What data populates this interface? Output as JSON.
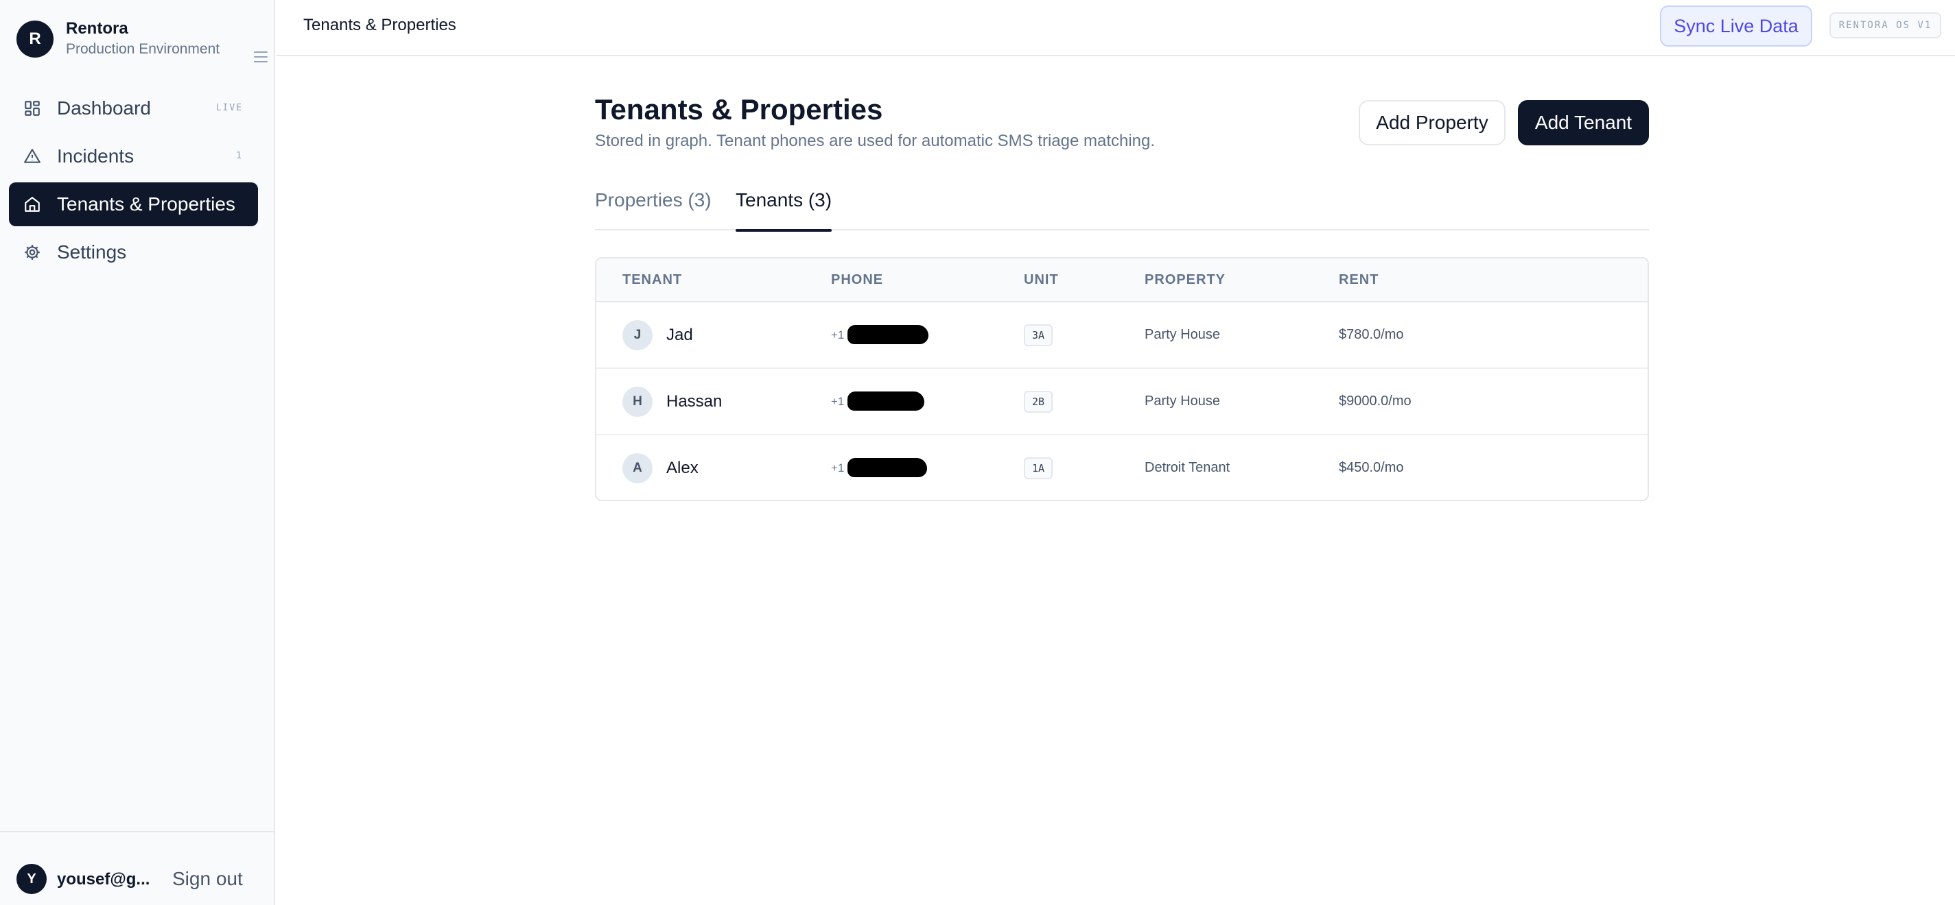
{
  "brand": {
    "initial": "R",
    "name": "Rentora",
    "environment": "Production Environment"
  },
  "sidebar": {
    "items": [
      {
        "label": "Dashboard",
        "badge": "LIVE",
        "icon": "dashboard-icon"
      },
      {
        "label": "Incidents",
        "badge": "1",
        "icon": "warning-triangle-icon"
      },
      {
        "label": "Tenants & Properties",
        "badge": "",
        "icon": "home-icon",
        "active": true
      },
      {
        "label": "Settings",
        "badge": "",
        "icon": "gear-icon"
      }
    ]
  },
  "user": {
    "initial": "Y",
    "email": "yousef@g...",
    "sign_out_label": "Sign out"
  },
  "topbar": {
    "title": "Tenants & Properties",
    "sync_label": "Sync Live Data",
    "version": "RENTORA OS V1"
  },
  "page": {
    "title": "Tenants & Properties",
    "subtitle": "Stored in graph. Tenant phones are used for automatic SMS triage matching.",
    "add_property_label": "Add Property",
    "add_tenant_label": "Add Tenant"
  },
  "tabs": [
    {
      "label": "Properties (3)",
      "active": false
    },
    {
      "label": "Tenants (3)",
      "active": true
    }
  ],
  "table": {
    "headers": [
      "TENANT",
      "PHONE",
      "UNIT",
      "PROPERTY",
      "RENT"
    ],
    "rows": [
      {
        "initial": "J",
        "name": "Jad",
        "phone_prefix": "+1",
        "unit": "3A",
        "property": "Party House",
        "rent": "$780.0/mo"
      },
      {
        "initial": "H",
        "name": "Hassan",
        "phone_prefix": "+1",
        "unit": "2B",
        "property": "Party House",
        "rent": "$9000.0/mo"
      },
      {
        "initial": "A",
        "name": "Alex",
        "phone_prefix": "+1",
        "unit": "1A",
        "property": "Detroit Tenant",
        "rent": "$450.0/mo"
      }
    ]
  },
  "colors": {
    "primary": "#0f172a",
    "accent": "#4f46e5",
    "accent_bg": "#eef2ff",
    "muted": "#64748b"
  }
}
